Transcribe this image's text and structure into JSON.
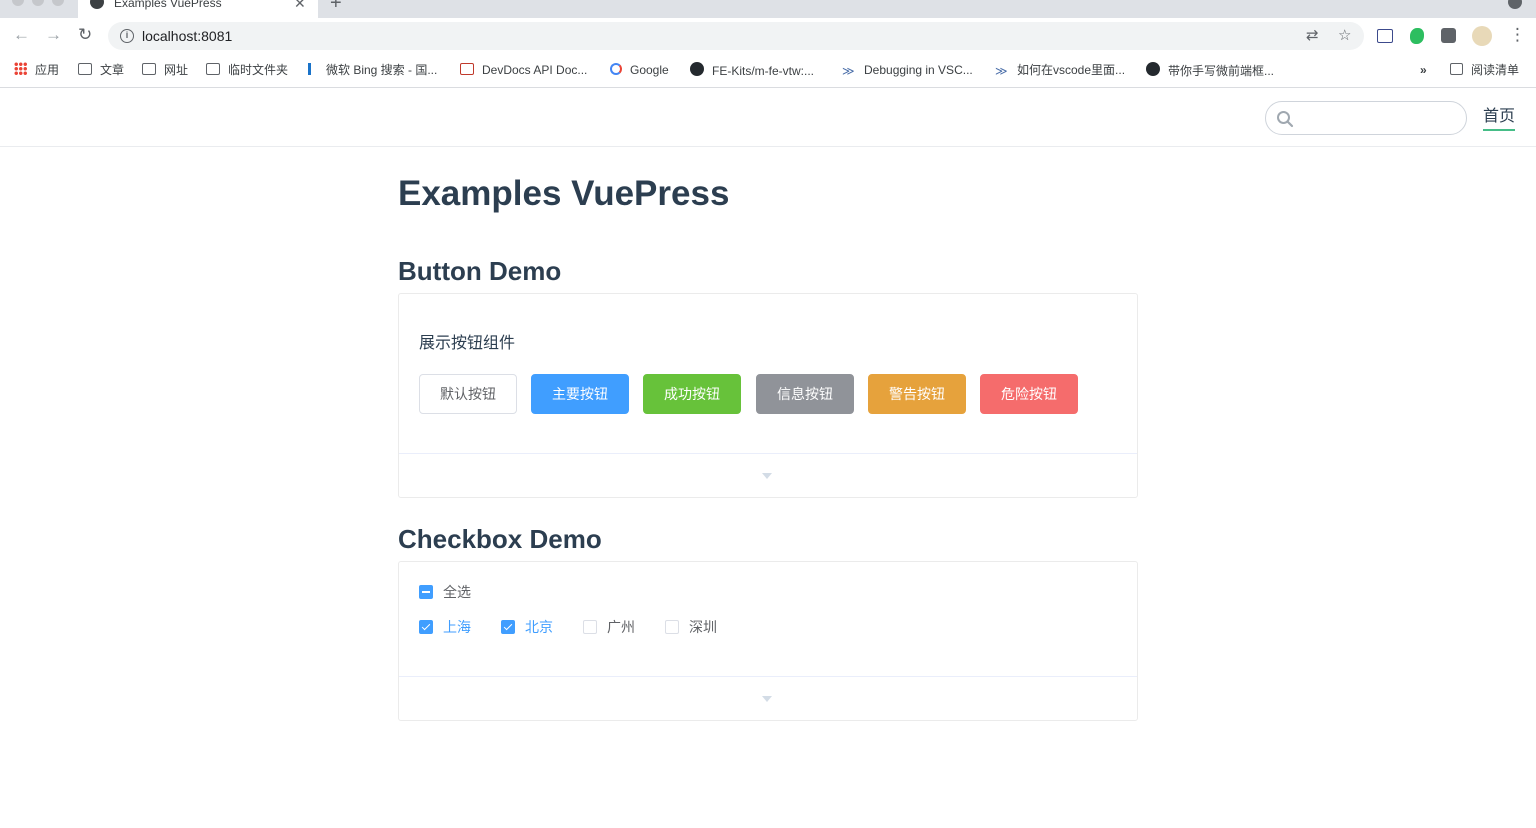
{
  "browser": {
    "tab_title": "Examples VuePress",
    "tab_close": "✕",
    "new_tab": "+",
    "url": "localhost:8081",
    "bookmarks": [
      "应用",
      "文章",
      "网址",
      "临时文件夹",
      "微软 Bing 搜索 - 国...",
      "DevDocs API Doc...",
      "Google",
      "FE-Kits/m-fe-vtw:...",
      "Debugging in VSC...",
      "如何在vscode里面...",
      "带你手写微前端框..."
    ],
    "bookmarks_more": "»",
    "reading_list": "阅读清单"
  },
  "site": {
    "search_placeholder": "",
    "nav_home": "首页"
  },
  "page": {
    "title": "Examples VuePress",
    "button_demo": {
      "heading": "Button Demo",
      "description": "展示按钮组件",
      "buttons": [
        {
          "label": "默认按钮",
          "color": "#ffffff"
        },
        {
          "label": "主要按钮",
          "color": "#409eff"
        },
        {
          "label": "成功按钮",
          "color": "#67c23a"
        },
        {
          "label": "信息按钮",
          "color": "#909399"
        },
        {
          "label": "警告按钮",
          "color": "#e6a23c"
        },
        {
          "label": "危险按钮",
          "color": "#f56c6c"
        }
      ]
    },
    "checkbox_demo": {
      "heading": "Checkbox Demo",
      "select_all": {
        "label": "全选",
        "state": "indeterminate"
      },
      "options": [
        {
          "label": "上海",
          "checked": true
        },
        {
          "label": "北京",
          "checked": true
        },
        {
          "label": "广州",
          "checked": false
        },
        {
          "label": "深圳",
          "checked": false
        }
      ]
    }
  }
}
